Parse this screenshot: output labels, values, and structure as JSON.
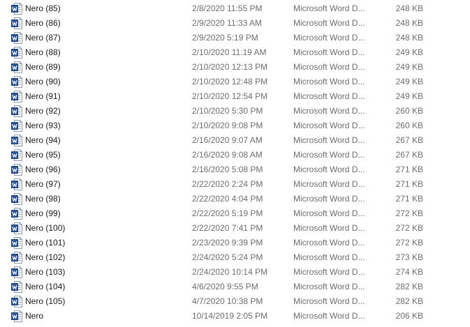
{
  "files": [
    {
      "name": "Nero (85)",
      "date": "2/8/2020 11:55 PM",
      "type": "Microsoft Word D...",
      "size": "248 KB",
      "icon": "word-doc-icon"
    },
    {
      "name": "Nero (86)",
      "date": "2/9/2020 11:33 AM",
      "type": "Microsoft Word D...",
      "size": "248 KB",
      "icon": "word-doc-icon"
    },
    {
      "name": "Nero (87)",
      "date": "2/9/2020 5:19 PM",
      "type": "Microsoft Word D...",
      "size": "248 KB",
      "icon": "word-doc-icon"
    },
    {
      "name": "Nero (88)",
      "date": "2/10/2020 11:19 AM",
      "type": "Microsoft Word D...",
      "size": "249 KB",
      "icon": "word-doc-icon"
    },
    {
      "name": "Nero (89)",
      "date": "2/10/2020 12:13 PM",
      "type": "Microsoft Word D...",
      "size": "249 KB",
      "icon": "word-doc-icon"
    },
    {
      "name": "Nero (90)",
      "date": "2/10/2020 12:48 PM",
      "type": "Microsoft Word D...",
      "size": "249 KB",
      "icon": "word-doc-icon"
    },
    {
      "name": "Nero (91)",
      "date": "2/10/2020 12:54 PM",
      "type": "Microsoft Word D...",
      "size": "249 KB",
      "icon": "word-doc-icon"
    },
    {
      "name": "Nero (92)",
      "date": "2/10/2020 5:30 PM",
      "type": "Microsoft Word D...",
      "size": "260 KB",
      "icon": "word-doc-icon"
    },
    {
      "name": "Nero (93)",
      "date": "2/10/2020 9:08 PM",
      "type": "Microsoft Word D...",
      "size": "260 KB",
      "icon": "word-doc-icon"
    },
    {
      "name": "Nero (94)",
      "date": "2/16/2020 9:07 AM",
      "type": "Microsoft Word D...",
      "size": "267 KB",
      "icon": "word-doc-icon"
    },
    {
      "name": "Nero (95)",
      "date": "2/16/2020 9:08 AM",
      "type": "Microsoft Word D...",
      "size": "267 KB",
      "icon": "word-doc-icon"
    },
    {
      "name": "Nero (96)",
      "date": "2/16/2020 5:08 PM",
      "type": "Microsoft Word D...",
      "size": "271 KB",
      "icon": "word-doc-icon"
    },
    {
      "name": "Nero (97)",
      "date": "2/22/2020 2:24 PM",
      "type": "Microsoft Word D...",
      "size": "271 KB",
      "icon": "word-doc-icon"
    },
    {
      "name": "Nero (98)",
      "date": "2/22/2020 4:04 PM",
      "type": "Microsoft Word D...",
      "size": "271 KB",
      "icon": "word-doc-icon"
    },
    {
      "name": "Nero (99)",
      "date": "2/22/2020 5:19 PM",
      "type": "Microsoft Word D...",
      "size": "272 KB",
      "icon": "word-doc-icon"
    },
    {
      "name": "Nero (100)",
      "date": "2/22/2020 7:41 PM",
      "type": "Microsoft Word D...",
      "size": "272 KB",
      "icon": "word-doc-icon"
    },
    {
      "name": "Nero (101)",
      "date": "2/23/2020 9:39 PM",
      "type": "Microsoft Word D...",
      "size": "272 KB",
      "icon": "word-doc-icon"
    },
    {
      "name": "Nero (102)",
      "date": "2/24/2020 5:24 PM",
      "type": "Microsoft Word D...",
      "size": "273 KB",
      "icon": "word-doc-icon"
    },
    {
      "name": "Nero (103)",
      "date": "2/24/2020 10:14 PM",
      "type": "Microsoft Word D...",
      "size": "274 KB",
      "icon": "word-doc-icon"
    },
    {
      "name": "Nero (104)",
      "date": "4/6/2020 9:55 PM",
      "type": "Microsoft Word D...",
      "size": "282 KB",
      "icon": "word-doc-icon"
    },
    {
      "name": "Nero (105)",
      "date": "4/7/2020 10:38 PM",
      "type": "Microsoft Word D...",
      "size": "282 KB",
      "icon": "word-doc-icon"
    },
    {
      "name": "Nero",
      "date": "10/14/2019 2:05 PM",
      "type": "Microsoft Word D...",
      "size": "206 KB",
      "icon": "word-doc-icon"
    }
  ],
  "colors": {
    "icon_blue": "#2b579a",
    "icon_blue_dark": "#1e4079",
    "icon_page": "#ffffff",
    "icon_border": "#8a9bb8",
    "icon_lines": "#9bb0d0",
    "secondary_text": "#6d6d6d"
  }
}
